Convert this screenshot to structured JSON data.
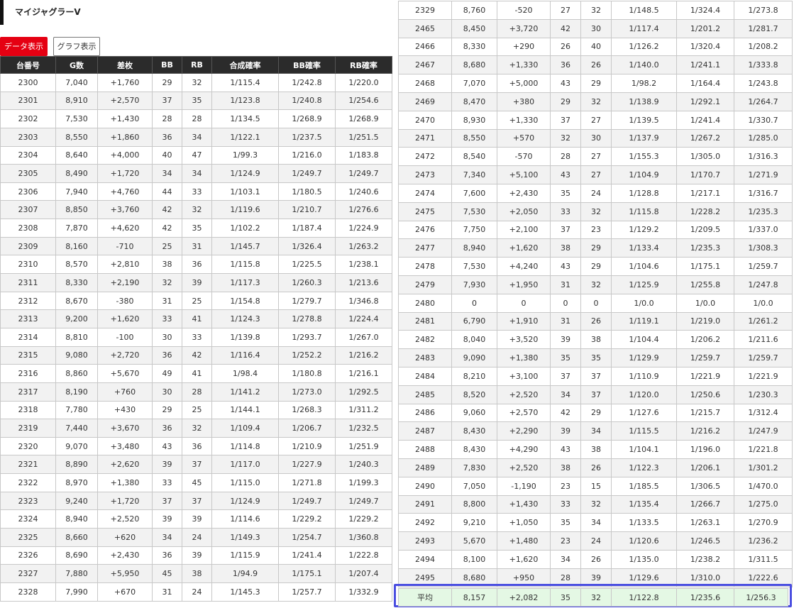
{
  "title": "マイジャグラーV",
  "buttons": {
    "data": "データ表示",
    "graph": "グラフ表示"
  },
  "columns": [
    "台番号",
    "G数",
    "差枚",
    "BB",
    "RB",
    "合成確率",
    "BB確率",
    "RB確率"
  ],
  "left_rows": [
    [
      "2300",
      "7,040",
      "+1,760",
      "29",
      "32",
      "1/115.4",
      "1/242.8",
      "1/220.0"
    ],
    [
      "2301",
      "8,910",
      "+2,570",
      "37",
      "35",
      "1/123.8",
      "1/240.8",
      "1/254.6"
    ],
    [
      "2302",
      "7,530",
      "+1,430",
      "28",
      "28",
      "1/134.5",
      "1/268.9",
      "1/268.9"
    ],
    [
      "2303",
      "8,550",
      "+1,860",
      "36",
      "34",
      "1/122.1",
      "1/237.5",
      "1/251.5"
    ],
    [
      "2304",
      "8,640",
      "+4,000",
      "40",
      "47",
      "1/99.3",
      "1/216.0",
      "1/183.8"
    ],
    [
      "2305",
      "8,490",
      "+1,720",
      "34",
      "34",
      "1/124.9",
      "1/249.7",
      "1/249.7"
    ],
    [
      "2306",
      "7,940",
      "+4,760",
      "44",
      "33",
      "1/103.1",
      "1/180.5",
      "1/240.6"
    ],
    [
      "2307",
      "8,850",
      "+3,760",
      "42",
      "32",
      "1/119.6",
      "1/210.7",
      "1/276.6"
    ],
    [
      "2308",
      "7,870",
      "+4,620",
      "42",
      "35",
      "1/102.2",
      "1/187.4",
      "1/224.9"
    ],
    [
      "2309",
      "8,160",
      "-710",
      "25",
      "31",
      "1/145.7",
      "1/326.4",
      "1/263.2"
    ],
    [
      "2310",
      "8,570",
      "+2,810",
      "38",
      "36",
      "1/115.8",
      "1/225.5",
      "1/238.1"
    ],
    [
      "2311",
      "8,330",
      "+2,190",
      "32",
      "39",
      "1/117.3",
      "1/260.3",
      "1/213.6"
    ],
    [
      "2312",
      "8,670",
      "-380",
      "31",
      "25",
      "1/154.8",
      "1/279.7",
      "1/346.8"
    ],
    [
      "2313",
      "9,200",
      "+1,620",
      "33",
      "41",
      "1/124.3",
      "1/278.8",
      "1/224.4"
    ],
    [
      "2314",
      "8,810",
      "-100",
      "30",
      "33",
      "1/139.8",
      "1/293.7",
      "1/267.0"
    ],
    [
      "2315",
      "9,080",
      "+2,720",
      "36",
      "42",
      "1/116.4",
      "1/252.2",
      "1/216.2"
    ],
    [
      "2316",
      "8,860",
      "+5,670",
      "49",
      "41",
      "1/98.4",
      "1/180.8",
      "1/216.1"
    ],
    [
      "2317",
      "8,190",
      "+760",
      "30",
      "28",
      "1/141.2",
      "1/273.0",
      "1/292.5"
    ],
    [
      "2318",
      "7,780",
      "+430",
      "29",
      "25",
      "1/144.1",
      "1/268.3",
      "1/311.2"
    ],
    [
      "2319",
      "7,440",
      "+3,670",
      "36",
      "32",
      "1/109.4",
      "1/206.7",
      "1/232.5"
    ],
    [
      "2320",
      "9,070",
      "+3,480",
      "43",
      "36",
      "1/114.8",
      "1/210.9",
      "1/251.9"
    ],
    [
      "2321",
      "8,890",
      "+2,620",
      "39",
      "37",
      "1/117.0",
      "1/227.9",
      "1/240.3"
    ],
    [
      "2322",
      "8,970",
      "+1,380",
      "33",
      "45",
      "1/115.0",
      "1/271.8",
      "1/199.3"
    ],
    [
      "2323",
      "9,240",
      "+1,720",
      "37",
      "37",
      "1/124.9",
      "1/249.7",
      "1/249.7"
    ],
    [
      "2324",
      "8,940",
      "+2,520",
      "39",
      "39",
      "1/114.6",
      "1/229.2",
      "1/229.2"
    ],
    [
      "2325",
      "8,660",
      "+620",
      "34",
      "24",
      "1/149.3",
      "1/254.7",
      "1/360.8"
    ],
    [
      "2326",
      "8,690",
      "+2,430",
      "36",
      "39",
      "1/115.9",
      "1/241.4",
      "1/222.8"
    ],
    [
      "2327",
      "7,880",
      "+5,950",
      "45",
      "38",
      "1/94.9",
      "1/175.1",
      "1/207.4"
    ],
    [
      "2328",
      "7,990",
      "+670",
      "31",
      "24",
      "1/145.3",
      "1/257.7",
      "1/332.9"
    ]
  ],
  "right_rows": [
    [
      "2329",
      "8,760",
      "-520",
      "27",
      "32",
      "1/148.5",
      "1/324.4",
      "1/273.8"
    ],
    [
      "2465",
      "8,450",
      "+3,720",
      "42",
      "30",
      "1/117.4",
      "1/201.2",
      "1/281.7"
    ],
    [
      "2466",
      "8,330",
      "+290",
      "26",
      "40",
      "1/126.2",
      "1/320.4",
      "1/208.2"
    ],
    [
      "2467",
      "8,680",
      "+1,330",
      "36",
      "26",
      "1/140.0",
      "1/241.1",
      "1/333.8"
    ],
    [
      "2468",
      "7,070",
      "+5,000",
      "43",
      "29",
      "1/98.2",
      "1/164.4",
      "1/243.8"
    ],
    [
      "2469",
      "8,470",
      "+380",
      "29",
      "32",
      "1/138.9",
      "1/292.1",
      "1/264.7"
    ],
    [
      "2470",
      "8,930",
      "+1,330",
      "37",
      "27",
      "1/139.5",
      "1/241.4",
      "1/330.7"
    ],
    [
      "2471",
      "8,550",
      "+570",
      "32",
      "30",
      "1/137.9",
      "1/267.2",
      "1/285.0"
    ],
    [
      "2472",
      "8,540",
      "-570",
      "28",
      "27",
      "1/155.3",
      "1/305.0",
      "1/316.3"
    ],
    [
      "2473",
      "7,340",
      "+5,100",
      "43",
      "27",
      "1/104.9",
      "1/170.7",
      "1/271.9"
    ],
    [
      "2474",
      "7,600",
      "+2,430",
      "35",
      "24",
      "1/128.8",
      "1/217.1",
      "1/316.7"
    ],
    [
      "2475",
      "7,530",
      "+2,050",
      "33",
      "32",
      "1/115.8",
      "1/228.2",
      "1/235.3"
    ],
    [
      "2476",
      "7,750",
      "+2,100",
      "37",
      "23",
      "1/129.2",
      "1/209.5",
      "1/337.0"
    ],
    [
      "2477",
      "8,940",
      "+1,620",
      "38",
      "29",
      "1/133.4",
      "1/235.3",
      "1/308.3"
    ],
    [
      "2478",
      "7,530",
      "+4,240",
      "43",
      "29",
      "1/104.6",
      "1/175.1",
      "1/259.7"
    ],
    [
      "2479",
      "7,930",
      "+1,950",
      "31",
      "32",
      "1/125.9",
      "1/255.8",
      "1/247.8"
    ],
    [
      "2480",
      "0",
      "0",
      "0",
      "0",
      "1/0.0",
      "1/0.0",
      "1/0.0"
    ],
    [
      "2481",
      "6,790",
      "+1,910",
      "31",
      "26",
      "1/119.1",
      "1/219.0",
      "1/261.2"
    ],
    [
      "2482",
      "8,040",
      "+3,520",
      "39",
      "38",
      "1/104.4",
      "1/206.2",
      "1/211.6"
    ],
    [
      "2483",
      "9,090",
      "+1,380",
      "35",
      "35",
      "1/129.9",
      "1/259.7",
      "1/259.7"
    ],
    [
      "2484",
      "8,210",
      "+3,100",
      "37",
      "37",
      "1/110.9",
      "1/221.9",
      "1/221.9"
    ],
    [
      "2485",
      "8,520",
      "+2,520",
      "34",
      "37",
      "1/120.0",
      "1/250.6",
      "1/230.3"
    ],
    [
      "2486",
      "9,060",
      "+2,570",
      "42",
      "29",
      "1/127.6",
      "1/215.7",
      "1/312.4"
    ],
    [
      "2487",
      "8,430",
      "+2,290",
      "39",
      "34",
      "1/115.5",
      "1/216.2",
      "1/247.9"
    ],
    [
      "2488",
      "8,430",
      "+4,290",
      "43",
      "38",
      "1/104.1",
      "1/196.0",
      "1/221.8"
    ],
    [
      "2489",
      "7,830",
      "+2,520",
      "38",
      "26",
      "1/122.3",
      "1/206.1",
      "1/301.2"
    ],
    [
      "2490",
      "7,050",
      "-1,190",
      "23",
      "15",
      "1/185.5",
      "1/306.5",
      "1/470.0"
    ],
    [
      "2491",
      "8,800",
      "+1,430",
      "33",
      "32",
      "1/135.4",
      "1/266.7",
      "1/275.0"
    ],
    [
      "2492",
      "9,210",
      "+1,050",
      "35",
      "34",
      "1/133.5",
      "1/263.1",
      "1/270.9"
    ],
    [
      "2493",
      "5,670",
      "+1,480",
      "23",
      "24",
      "1/120.6",
      "1/246.5",
      "1/236.2"
    ],
    [
      "2494",
      "8,100",
      "+1,620",
      "34",
      "26",
      "1/135.0",
      "1/238.2",
      "1/311.5"
    ],
    [
      "2495",
      "8,680",
      "+950",
      "28",
      "39",
      "1/129.6",
      "1/310.0",
      "1/222.6"
    ]
  ],
  "average_row": [
    "平均",
    "8,157",
    "+2,082",
    "35",
    "32",
    "1/122.8",
    "1/235.6",
    "1/256.3"
  ],
  "colors": {
    "accent_red": "#e50012",
    "header_bg": "#2b2b2b",
    "avg_border": "#4a4ee0",
    "avg_bg": "#e4f8e4"
  }
}
